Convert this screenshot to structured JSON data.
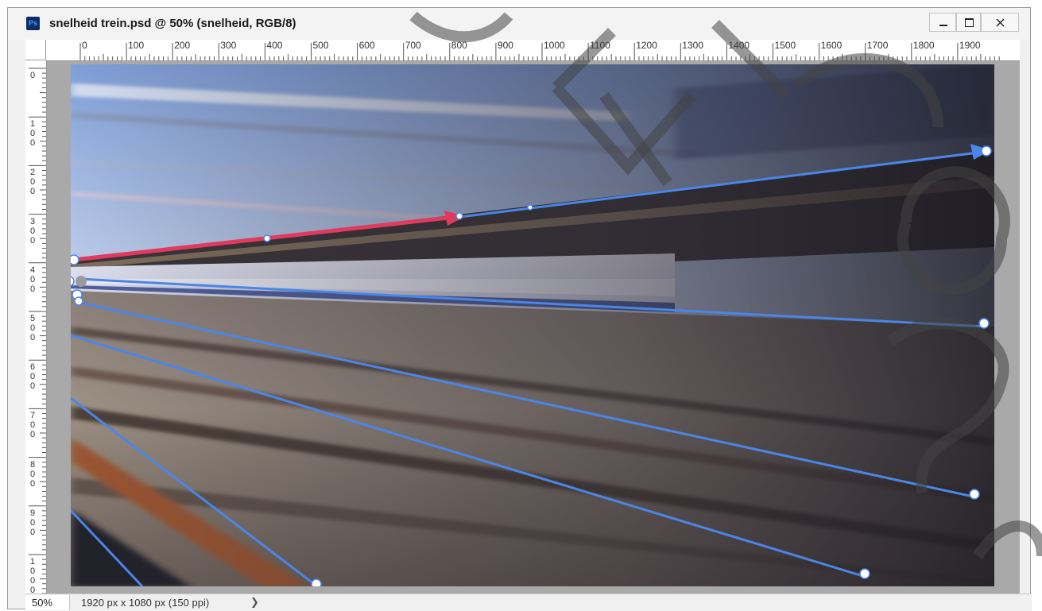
{
  "window": {
    "title": "snelheid trein.psd @ 50% (snelheid, RGB/8)",
    "app_icon_label": "Ps",
    "buttons": {
      "minimize": "minimize",
      "maximize": "maximize",
      "close": "close"
    }
  },
  "rulers": {
    "horizontal_labels": [
      "0",
      "100",
      "200",
      "300",
      "400",
      "500",
      "600",
      "700",
      "800",
      "900",
      "1000",
      "1100",
      "1200",
      "1300",
      "1400",
      "1500",
      "1600",
      "1700",
      "1800",
      "1900"
    ],
    "vertical_labels": [
      "0",
      "100",
      "200",
      "300",
      "400",
      "500",
      "600",
      "700",
      "800",
      "900",
      "1000"
    ]
  },
  "status": {
    "zoom": "50%",
    "doc_info": "1920 px x 1080 px (150 ppi)",
    "chevron": "❯"
  },
  "colors": {
    "accent_blue": "#4a86e8",
    "accent_red": "#e03a5e",
    "ps_icon": "#0f2b63"
  },
  "icons": {
    "app": "photoshop-icon",
    "minimize": "minimize-icon",
    "maximize": "maximize-icon",
    "close": "close-icon",
    "expand": "chevron-right-icon"
  }
}
